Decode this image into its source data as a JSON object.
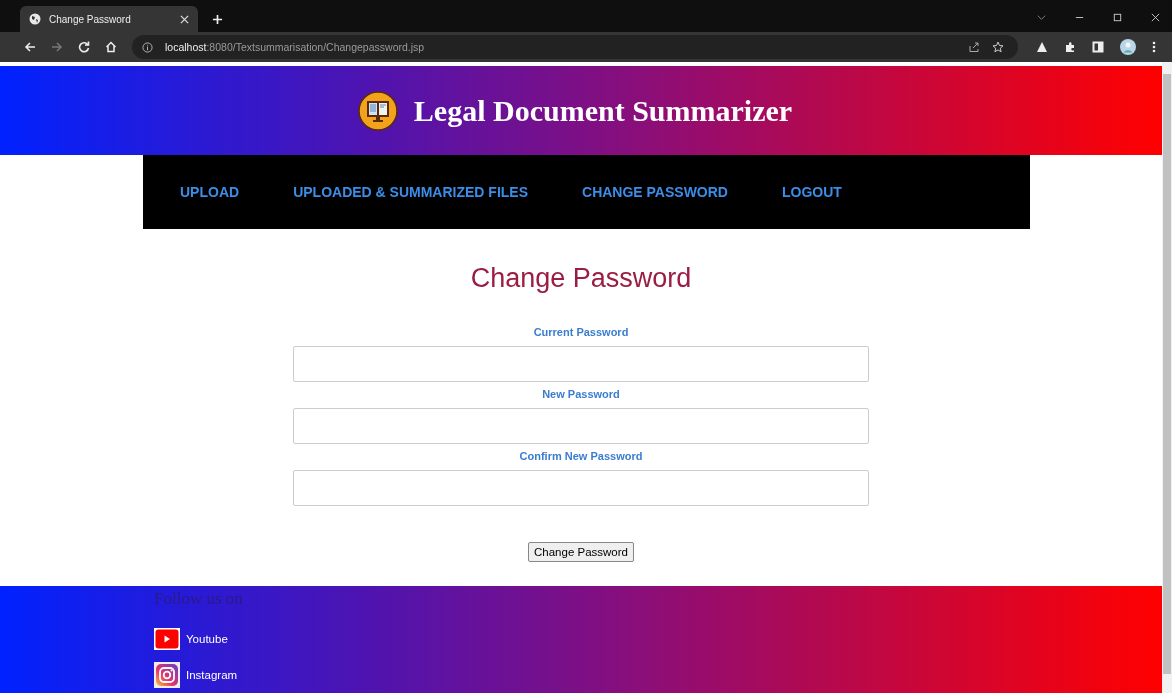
{
  "browser": {
    "tab_title": "Change Password",
    "url_host": "localhost",
    "url_path": ":8080/Textsummarisation/Changepassword.jsp"
  },
  "header": {
    "title": "Legal Document Summarizer"
  },
  "nav": [
    {
      "label": "UPLOAD"
    },
    {
      "label": "UPLOADED & SUMMARIZED FILES"
    },
    {
      "label": "CHANGE PASSWORD"
    },
    {
      "label": "LOGOUT"
    }
  ],
  "form": {
    "title": "Change Password",
    "fields": [
      {
        "label": "Current Password"
      },
      {
        "label": "New Password"
      },
      {
        "label": "Confirm New Password"
      }
    ],
    "submit": "Change Password"
  },
  "footer": {
    "heading": "Follow us on",
    "links": [
      {
        "kind": "youtube",
        "label": "Youtube"
      },
      {
        "kind": "instagram",
        "label": "Instagram"
      }
    ]
  }
}
